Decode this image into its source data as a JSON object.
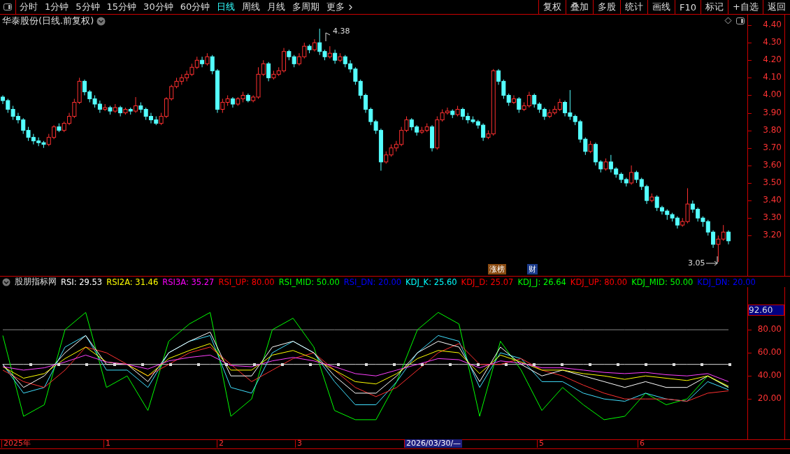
{
  "toolbar": {
    "periods": [
      {
        "label": "分时",
        "selected": false
      },
      {
        "label": "1分钟",
        "selected": false
      },
      {
        "label": "5分钟",
        "selected": false
      },
      {
        "label": "15分钟",
        "selected": false
      },
      {
        "label": "30分钟",
        "selected": false
      },
      {
        "label": "60分钟",
        "selected": false
      },
      {
        "label": "日线",
        "selected": true
      },
      {
        "label": "周线",
        "selected": false
      },
      {
        "label": "月线",
        "selected": false
      },
      {
        "label": "多周期",
        "selected": false
      },
      {
        "label": "更多",
        "selected": false
      }
    ],
    "actions": [
      "复权",
      "叠加",
      "多股",
      "统计",
      "画线",
      "F10",
      "标记",
      "+自选",
      "返回"
    ]
  },
  "chart": {
    "title": "华泰股份(日线.前复权)",
    "high_label": "4.38",
    "low_label": "3.05",
    "badges": [
      {
        "label": "涨榜",
        "color": "#8a4a10"
      },
      {
        "label": "财",
        "color": "#1a3a8a"
      }
    ],
    "chart_data": {
      "type": "candlestick",
      "ylim": [
        2.97,
        4.46
      ],
      "yticks": [
        {
          "value": 4.4,
          "label": "4.40"
        },
        {
          "value": 4.3,
          "label": "4.30"
        },
        {
          "value": 4.2,
          "label": "4.20"
        },
        {
          "value": 4.1,
          "label": "4.10"
        },
        {
          "value": 4.0,
          "label": "4.00"
        },
        {
          "value": 3.9,
          "label": "3.90"
        },
        {
          "value": 3.8,
          "label": "3.80"
        },
        {
          "value": 3.7,
          "label": "3.70"
        },
        {
          "value": 3.6,
          "label": "3.60"
        },
        {
          "value": 3.5,
          "label": "3.50"
        },
        {
          "value": 3.4,
          "label": "3.40"
        },
        {
          "value": 3.3,
          "label": "3.30"
        },
        {
          "value": 3.2,
          "label": "3.20"
        }
      ],
      "ohlc": [
        [
          3.99,
          4.0,
          3.95,
          3.97
        ],
        [
          3.97,
          3.98,
          3.9,
          3.92
        ],
        [
          3.92,
          3.94,
          3.86,
          3.88
        ],
        [
          3.88,
          3.9,
          3.84,
          3.86
        ],
        [
          3.86,
          3.87,
          3.78,
          3.8
        ],
        [
          3.8,
          3.82,
          3.74,
          3.76
        ],
        [
          3.76,
          3.78,
          3.72,
          3.74
        ],
        [
          3.74,
          3.76,
          3.71,
          3.73
        ],
        [
          3.73,
          3.74,
          3.7,
          3.72
        ],
        [
          3.72,
          3.78,
          3.71,
          3.76
        ],
        [
          3.76,
          3.83,
          3.75,
          3.82
        ],
        [
          3.82,
          3.84,
          3.79,
          3.8
        ],
        [
          3.8,
          3.85,
          3.79,
          3.84
        ],
        [
          3.84,
          3.9,
          3.83,
          3.88
        ],
        [
          3.88,
          3.98,
          3.87,
          3.96
        ],
        [
          3.96,
          4.1,
          3.95,
          4.08
        ],
        [
          4.08,
          4.09,
          4.0,
          4.02
        ],
        [
          4.02,
          4.03,
          3.96,
          3.98
        ],
        [
          3.98,
          4.0,
          3.93,
          3.95
        ],
        [
          3.95,
          3.97,
          3.9,
          3.92
        ],
        [
          3.92,
          3.95,
          3.91,
          3.93
        ],
        [
          3.93,
          3.94,
          3.89,
          3.91
        ],
        [
          3.91,
          3.95,
          3.9,
          3.93
        ],
        [
          3.93,
          3.94,
          3.88,
          3.9
        ],
        [
          3.9,
          3.93,
          3.89,
          3.92
        ],
        [
          3.92,
          3.93,
          3.89,
          3.91
        ],
        [
          3.91,
          3.99,
          3.9,
          3.94
        ],
        [
          3.94,
          3.96,
          3.9,
          3.92
        ],
        [
          3.92,
          3.93,
          3.86,
          3.88
        ],
        [
          3.88,
          3.9,
          3.84,
          3.86
        ],
        [
          3.86,
          3.88,
          3.83,
          3.84
        ],
        [
          3.84,
          3.9,
          3.83,
          3.88
        ],
        [
          3.88,
          3.99,
          3.87,
          3.98
        ],
        [
          3.98,
          4.06,
          3.97,
          4.05
        ],
        [
          4.05,
          4.1,
          4.04,
          4.08
        ],
        [
          4.08,
          4.12,
          4.06,
          4.1
        ],
        [
          4.1,
          4.14,
          4.08,
          4.12
        ],
        [
          4.12,
          4.18,
          4.11,
          4.16
        ],
        [
          4.16,
          4.22,
          4.15,
          4.2
        ],
        [
          4.2,
          4.22,
          4.16,
          4.18
        ],
        [
          4.18,
          4.24,
          4.17,
          4.22
        ],
        [
          4.22,
          4.23,
          4.12,
          4.14
        ],
        [
          4.14,
          4.15,
          3.9,
          3.92
        ],
        [
          3.92,
          3.98,
          3.9,
          3.96
        ],
        [
          3.96,
          4.0,
          3.94,
          3.98
        ],
        [
          3.98,
          3.99,
          3.93,
          3.95
        ],
        [
          3.95,
          3.99,
          3.94,
          3.98
        ],
        [
          3.98,
          4.02,
          3.96,
          4.0
        ],
        [
          4.0,
          4.01,
          3.96,
          3.97
        ],
        [
          3.97,
          4.0,
          3.96,
          3.99
        ],
        [
          3.99,
          4.16,
          3.98,
          4.12
        ],
        [
          4.12,
          4.2,
          4.11,
          4.18
        ],
        [
          4.18,
          4.19,
          4.08,
          4.1
        ],
        [
          4.1,
          4.14,
          4.09,
          4.12
        ],
        [
          4.12,
          4.16,
          4.11,
          4.14
        ],
        [
          4.14,
          4.27,
          4.13,
          4.25
        ],
        [
          4.25,
          4.26,
          4.2,
          4.22
        ],
        [
          4.22,
          4.23,
          4.16,
          4.18
        ],
        [
          4.18,
          4.24,
          4.17,
          4.22
        ],
        [
          4.22,
          4.3,
          4.21,
          4.28
        ],
        [
          4.28,
          4.29,
          4.24,
          4.26
        ],
        [
          4.26,
          4.32,
          4.25,
          4.3
        ],
        [
          4.3,
          4.38,
          4.23,
          4.25
        ],
        [
          4.25,
          4.26,
          4.2,
          4.22
        ],
        [
          4.22,
          4.28,
          4.21,
          4.24
        ],
        [
          4.24,
          4.26,
          4.18,
          4.2
        ],
        [
          4.2,
          4.24,
          4.19,
          4.22
        ],
        [
          4.22,
          4.23,
          4.16,
          4.18
        ],
        [
          4.18,
          4.2,
          4.13,
          4.15
        ],
        [
          4.15,
          4.16,
          4.06,
          4.08
        ],
        [
          4.08,
          4.09,
          3.98,
          4.0
        ],
        [
          4.0,
          4.01,
          3.9,
          3.92
        ],
        [
          3.92,
          3.93,
          3.83,
          3.85
        ],
        [
          3.85,
          3.86,
          3.78,
          3.8
        ],
        [
          3.8,
          3.81,
          3.57,
          3.62
        ],
        [
          3.62,
          3.68,
          3.61,
          3.66
        ],
        [
          3.66,
          3.72,
          3.65,
          3.7
        ],
        [
          3.7,
          3.74,
          3.68,
          3.72
        ],
        [
          3.72,
          3.82,
          3.71,
          3.8
        ],
        [
          3.8,
          3.88,
          3.79,
          3.86
        ],
        [
          3.86,
          3.87,
          3.8,
          3.82
        ],
        [
          3.82,
          3.83,
          3.77,
          3.79
        ],
        [
          3.79,
          3.82,
          3.78,
          3.8
        ],
        [
          3.8,
          3.84,
          3.79,
          3.82
        ],
        [
          3.82,
          3.83,
          3.68,
          3.7
        ],
        [
          3.7,
          3.88,
          3.69,
          3.86
        ],
        [
          3.86,
          3.92,
          3.85,
          3.9
        ],
        [
          3.9,
          3.93,
          3.89,
          3.91
        ],
        [
          3.91,
          3.92,
          3.87,
          3.89
        ],
        [
          3.89,
          3.94,
          3.88,
          3.92
        ],
        [
          3.92,
          3.93,
          3.86,
          3.88
        ],
        [
          3.88,
          3.9,
          3.84,
          3.86
        ],
        [
          3.86,
          3.88,
          3.84,
          3.85
        ],
        [
          3.85,
          3.86,
          3.81,
          3.83
        ],
        [
          3.83,
          3.84,
          3.74,
          3.76
        ],
        [
          3.76,
          3.8,
          3.75,
          3.78
        ],
        [
          3.78,
          4.15,
          3.77,
          4.14
        ],
        [
          4.14,
          4.15,
          4.06,
          4.08
        ],
        [
          4.08,
          4.09,
          3.98,
          4.0
        ],
        [
          4.0,
          4.01,
          3.94,
          3.96
        ],
        [
          3.96,
          4.0,
          3.95,
          3.98
        ],
        [
          3.98,
          3.99,
          3.9,
          3.92
        ],
        [
          3.92,
          3.96,
          3.91,
          3.94
        ],
        [
          3.94,
          4.02,
          3.93,
          4.0
        ],
        [
          4.0,
          4.01,
          3.93,
          3.95
        ],
        [
          3.95,
          3.96,
          3.9,
          3.92
        ],
        [
          3.92,
          3.93,
          3.86,
          3.88
        ],
        [
          3.88,
          3.92,
          3.87,
          3.9
        ],
        [
          3.9,
          3.94,
          3.89,
          3.92
        ],
        [
          3.92,
          3.98,
          3.91,
          3.96
        ],
        [
          3.96,
          3.97,
          3.88,
          3.9
        ],
        [
          3.9,
          4.03,
          3.86,
          3.88
        ],
        [
          3.88,
          3.89,
          3.83,
          3.85
        ],
        [
          3.85,
          3.86,
          3.73,
          3.75
        ],
        [
          3.75,
          3.76,
          3.66,
          3.68
        ],
        [
          3.68,
          3.74,
          3.67,
          3.72
        ],
        [
          3.72,
          3.73,
          3.6,
          3.62
        ],
        [
          3.62,
          3.63,
          3.56,
          3.58
        ],
        [
          3.58,
          3.64,
          3.57,
          3.62
        ],
        [
          3.62,
          3.66,
          3.56,
          3.58
        ],
        [
          3.58,
          3.59,
          3.53,
          3.55
        ],
        [
          3.55,
          3.56,
          3.5,
          3.52
        ],
        [
          3.52,
          3.53,
          3.48,
          3.5
        ],
        [
          3.5,
          3.6,
          3.49,
          3.56
        ],
        [
          3.56,
          3.57,
          3.5,
          3.52
        ],
        [
          3.52,
          3.53,
          3.46,
          3.48
        ],
        [
          3.48,
          3.49,
          3.38,
          3.4
        ],
        [
          3.4,
          3.44,
          3.39,
          3.42
        ],
        [
          3.42,
          3.43,
          3.34,
          3.36
        ],
        [
          3.36,
          3.37,
          3.32,
          3.34
        ],
        [
          3.34,
          3.35,
          3.29,
          3.32
        ],
        [
          3.32,
          3.33,
          3.28,
          3.3
        ],
        [
          3.3,
          3.31,
          3.24,
          3.26
        ],
        [
          3.26,
          3.3,
          3.25,
          3.28
        ],
        [
          3.28,
          3.47,
          3.27,
          3.38
        ],
        [
          3.38,
          3.4,
          3.33,
          3.35
        ],
        [
          3.35,
          3.36,
          3.28,
          3.3
        ],
        [
          3.3,
          3.31,
          3.25,
          3.28
        ],
        [
          3.28,
          3.29,
          3.2,
          3.22
        ],
        [
          3.22,
          3.23,
          3.13,
          3.15
        ],
        [
          3.15,
          3.2,
          3.05,
          3.18
        ],
        [
          3.18,
          3.26,
          3.17,
          3.22
        ],
        [
          3.22,
          3.23,
          3.15,
          3.17
        ]
      ]
    }
  },
  "indicator": {
    "name": "股朋指标网",
    "legend": [
      {
        "text": "RSI: 29.53",
        "color": "#ffffff"
      },
      {
        "text": "RSI2A: 31.46",
        "color": "#ffff00"
      },
      {
        "text": "RSI3A: 35.27",
        "color": "#ff00ff"
      },
      {
        "text": "RSI_UP: 80.00",
        "color": "#ff0000"
      },
      {
        "text": "RSI_MID: 50.00",
        "color": "#00ff00"
      },
      {
        "text": "RSI_DN: 20.00",
        "color": "#0000ff"
      },
      {
        "text": "KDJ_K: 25.60",
        "color": "#00ffff"
      },
      {
        "text": "KDJ_D: 25.07",
        "color": "#ff0000"
      },
      {
        "text": "KDJ_J: 26.64",
        "color": "#00ff00"
      },
      {
        "text": "KDJ_UP: 80.00",
        "color": "#ff0000"
      },
      {
        "text": "KDJ_MID: 50.00",
        "color": "#00ff00"
      },
      {
        "text": "KDJ_DN: 20.00",
        "color": "#0000ff"
      }
    ],
    "current_value": "92.60",
    "chart_data": {
      "type": "line",
      "ylim": [
        -15,
        117
      ],
      "yticks": [
        {
          "value": 80,
          "label": "80.00"
        },
        {
          "value": 60,
          "label": "60.00"
        },
        {
          "value": 40,
          "label": "40.00"
        },
        {
          "value": 20,
          "label": "20.00"
        }
      ],
      "series": [
        {
          "color": "#888888",
          "values": [
            80,
            80,
            80,
            80,
            80,
            80,
            80,
            80,
            80,
            80,
            80,
            80,
            80,
            80,
            80,
            80,
            80,
            80,
            80,
            80,
            80,
            80,
            80,
            80,
            80,
            80,
            80,
            80,
            80,
            80,
            80,
            80,
            80,
            80,
            80,
            80
          ]
        },
        {
          "color": "#dddddd",
          "values": [
            50,
            50,
            50,
            50,
            50,
            50,
            50,
            50,
            50,
            50,
            50,
            50,
            50,
            50,
            50,
            50,
            50,
            50,
            50,
            50,
            50,
            50,
            50,
            50,
            50,
            50,
            50,
            50,
            50,
            50,
            50,
            50,
            50,
            50,
            50,
            50
          ]
        },
        {
          "color": "#00ff00",
          "values": [
            75,
            5,
            15,
            80,
            95,
            30,
            40,
            10,
            70,
            85,
            95,
            5,
            20,
            80,
            90,
            65,
            10,
            2,
            2,
            35,
            80,
            95,
            85,
            5,
            70,
            45,
            10,
            30,
            15,
            2,
            5,
            25,
            15,
            20,
            40,
            30
          ]
        },
        {
          "color": "#40e0ff",
          "values": [
            50,
            25,
            30,
            65,
            75,
            45,
            45,
            30,
            60,
            70,
            75,
            30,
            25,
            60,
            70,
            60,
            35,
            15,
            15,
            35,
            60,
            75,
            70,
            30,
            60,
            55,
            35,
            35,
            25,
            20,
            18,
            25,
            20,
            18,
            35,
            28
          ]
        },
        {
          "color": "#ff3030",
          "values": [
            45,
            35,
            30,
            45,
            65,
            60,
            50,
            40,
            50,
            60,
            65,
            50,
            35,
            45,
            55,
            60,
            45,
            30,
            22,
            30,
            45,
            60,
            68,
            50,
            50,
            55,
            45,
            40,
            32,
            25,
            20,
            20,
            20,
            18,
            25,
            27
          ]
        },
        {
          "color": "#ffffff",
          "values": [
            50,
            30,
            40,
            60,
            75,
            50,
            50,
            35,
            60,
            70,
            78,
            40,
            40,
            65,
            70,
            60,
            40,
            25,
            25,
            40,
            60,
            70,
            65,
            35,
            65,
            50,
            40,
            45,
            40,
            35,
            30,
            35,
            30,
            30,
            40,
            30
          ]
        },
        {
          "color": "#ffff00",
          "values": [
            48,
            38,
            42,
            55,
            65,
            52,
            50,
            40,
            55,
            62,
            68,
            45,
            45,
            58,
            62,
            55,
            45,
            35,
            33,
            42,
            55,
            62,
            60,
            42,
            58,
            52,
            45,
            45,
            42,
            40,
            37,
            40,
            38,
            36,
            40,
            31
          ]
        },
        {
          "color": "#ff40ff",
          "values": [
            48,
            45,
            47,
            52,
            58,
            52,
            50,
            46,
            53,
            56,
            58,
            49,
            48,
            53,
            56,
            53,
            48,
            42,
            40,
            45,
            50,
            55,
            54,
            47,
            53,
            51,
            47,
            47,
            45,
            43,
            42,
            43,
            41,
            40,
            42,
            35
          ]
        }
      ]
    }
  },
  "time_axis": [
    {
      "label": "2025年",
      "kind": "month"
    },
    {
      "label": "1",
      "kind": "month"
    },
    {
      "label": "2",
      "kind": "month"
    },
    {
      "label": "3",
      "kind": "month"
    },
    {
      "label": "2026/03/30/—",
      "kind": "cursor"
    },
    {
      "label": "5",
      "kind": "month"
    },
    {
      "label": "6",
      "kind": "month"
    }
  ]
}
